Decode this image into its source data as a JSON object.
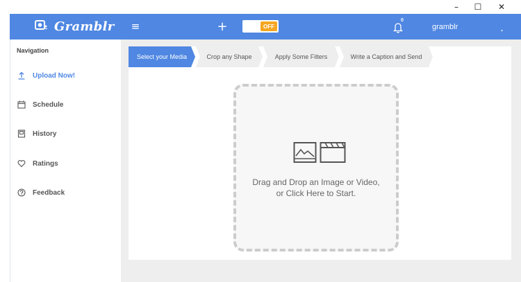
{
  "window": {
    "minimize_glyph": "–",
    "maximize_glyph": "☐",
    "close_glyph": "✕"
  },
  "header": {
    "brand_name": "Gramblr",
    "menu_glyph": "≡",
    "plus_glyph": "+",
    "toggle_label": "OFF",
    "notification_count": "0",
    "username": "gramblr",
    "accent_color": "#4f87e2",
    "toggle_color": "#f5a623"
  },
  "sidebar": {
    "heading": "Navigation",
    "items": [
      {
        "label": "Upload Now!",
        "icon": "upload-icon",
        "active": true
      },
      {
        "label": "Schedule",
        "icon": "calendar-icon",
        "active": false
      },
      {
        "label": "History",
        "icon": "history-icon",
        "active": false
      },
      {
        "label": "Ratings",
        "icon": "heart-icon",
        "active": false
      },
      {
        "label": "Feedback",
        "icon": "question-icon",
        "active": false
      }
    ]
  },
  "steps": [
    {
      "label": "Select your Media",
      "active": true
    },
    {
      "label": "Crop any Shape",
      "active": false
    },
    {
      "label": "Apply Some Filters",
      "active": false
    },
    {
      "label": "Write a Caption and Send",
      "active": false
    }
  ],
  "dropzone": {
    "line1": "Drag and Drop an Image or Video,",
    "line2": "or Click Here to Start."
  }
}
